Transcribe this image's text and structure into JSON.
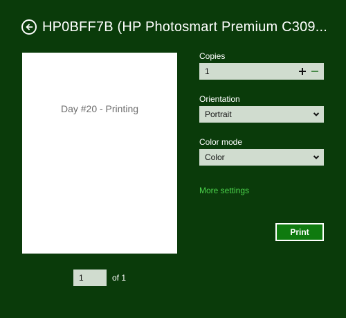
{
  "header": {
    "title": "HP0BFF7B (HP Photosmart Premium C309...",
    "back_icon": "back-arrow-icon"
  },
  "preview": {
    "page_text": "Day #20 - Printing",
    "current_page": "1",
    "page_of_label": "of 1"
  },
  "settings": {
    "copies": {
      "label": "Copies",
      "value": "1",
      "increment_icon": "plus-icon",
      "decrement_icon": "minus-icon"
    },
    "orientation": {
      "label": "Orientation",
      "selected": "Portrait",
      "icon": "chevron-down-icon"
    },
    "color_mode": {
      "label": "Color mode",
      "selected": "Color",
      "icon": "chevron-down-icon"
    },
    "more_settings_label": "More settings"
  },
  "actions": {
    "print_label": "Print"
  },
  "colors": {
    "background": "#0a3b0a",
    "field_background": "#d0dccf",
    "link": "#4cd44c",
    "print_button": "#0f7a0f"
  }
}
